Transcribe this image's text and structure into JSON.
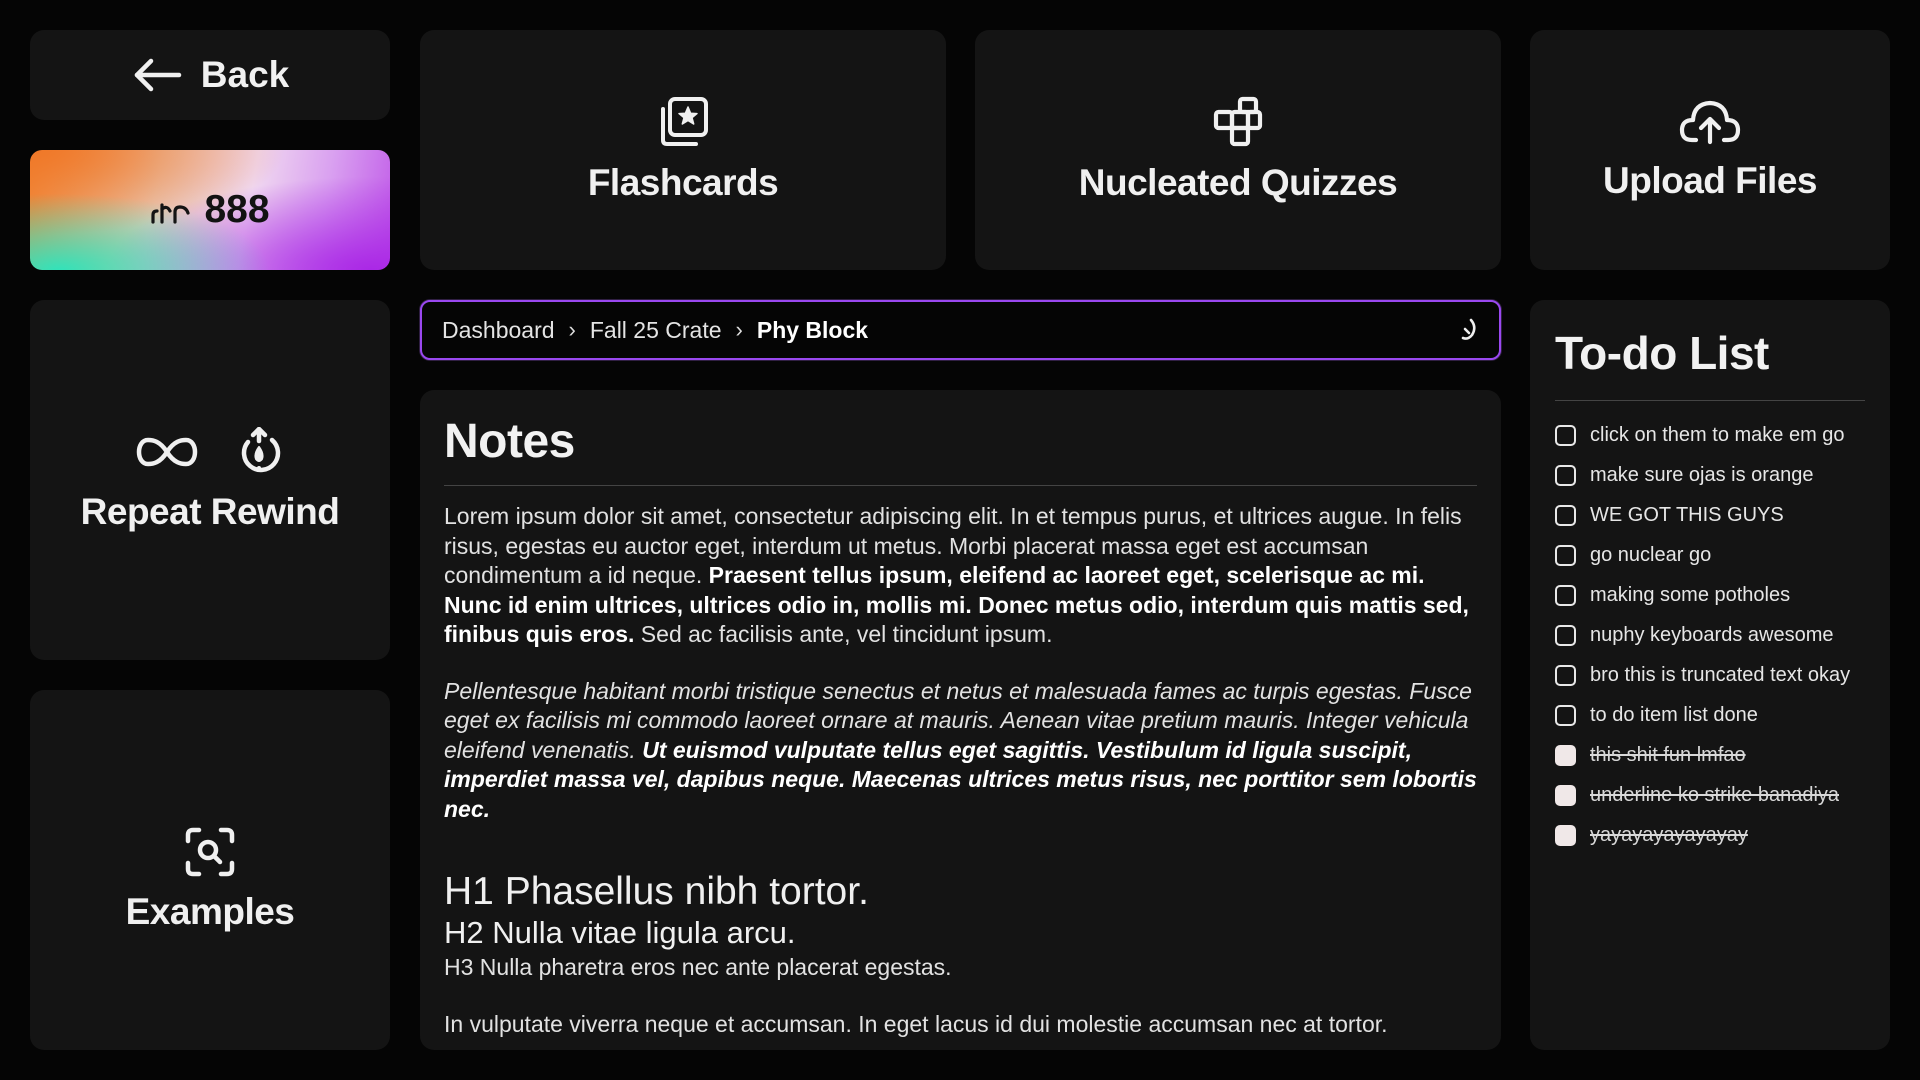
{
  "nav": {
    "back_label": "Back"
  },
  "streak": {
    "count": "888"
  },
  "tiles": {
    "flashcards": "Flashcards",
    "quizzes": "Nucleated Quizzes",
    "upload": "Upload Files",
    "repeat": "Repeat Rewind",
    "examples": "Examples"
  },
  "breadcrumb": {
    "items": [
      "Dashboard",
      "Fall 25 Crate",
      "Phy Block"
    ]
  },
  "notes": {
    "title": "Notes",
    "p1_plain": "Lorem ipsum dolor sit amet, consectetur adipiscing elit. In et tempus purus, et ultrices augue. In felis risus, egestas eu auctor eget, interdum ut metus. Morbi placerat massa eget est accumsan condimentum a id neque. ",
    "p1_bold": "Praesent tellus ipsum, eleifend ac laoreet eget, scelerisque ac mi. Nunc id enim ultrices, ultrices odio in, mollis mi. Donec metus odio, interdum quis mattis sed, finibus quis eros.",
    "p1_tail": " Sed ac facilisis ante, vel tincidunt ipsum.",
    "p2_italic": "Pellentesque habitant morbi tristique senectus et netus et malesuada fames ac turpis egestas. Fusce eget ex facilisis mi commodo laoreet ornare at mauris. Aenean vitae pretium mauris. Integer vehicula eleifend venenatis. ",
    "p2_bold": "Ut euismod vulputate tellus eget sagittis. Vestibulum id ligula suscipit, imperdiet massa vel, dapibus neque. Maecenas ultrices metus risus, nec porttitor sem lobortis nec.",
    "h1": "H1 Phasellus nibh tortor.",
    "h2": "H2 Nulla vitae ligula arcu.",
    "h3": "H3 Nulla pharetra eros nec ante placerat egestas.",
    "p3": "In vulputate viverra neque et accumsan. In eget lacus id dui molestie accumsan nec at tortor."
  },
  "todo": {
    "title": "To-do List",
    "items": [
      {
        "text": "click on them to make em go",
        "done": false
      },
      {
        "text": "make sure ojas is orange",
        "done": false
      },
      {
        "text": "WE GOT THIS GUYS",
        "done": false
      },
      {
        "text": "go nuclear go",
        "done": false
      },
      {
        "text": "making some potholes",
        "done": false
      },
      {
        "text": "nuphy keyboards awesome",
        "done": false
      },
      {
        "text": "bro this is truncated text okay",
        "done": false
      },
      {
        "text": "to do item list done",
        "done": false
      },
      {
        "text": "this shit fun lmfao",
        "done": true
      },
      {
        "text": "underline ko strike banadiya",
        "done": true
      },
      {
        "text": "yayayayayayayay",
        "done": true
      }
    ]
  }
}
